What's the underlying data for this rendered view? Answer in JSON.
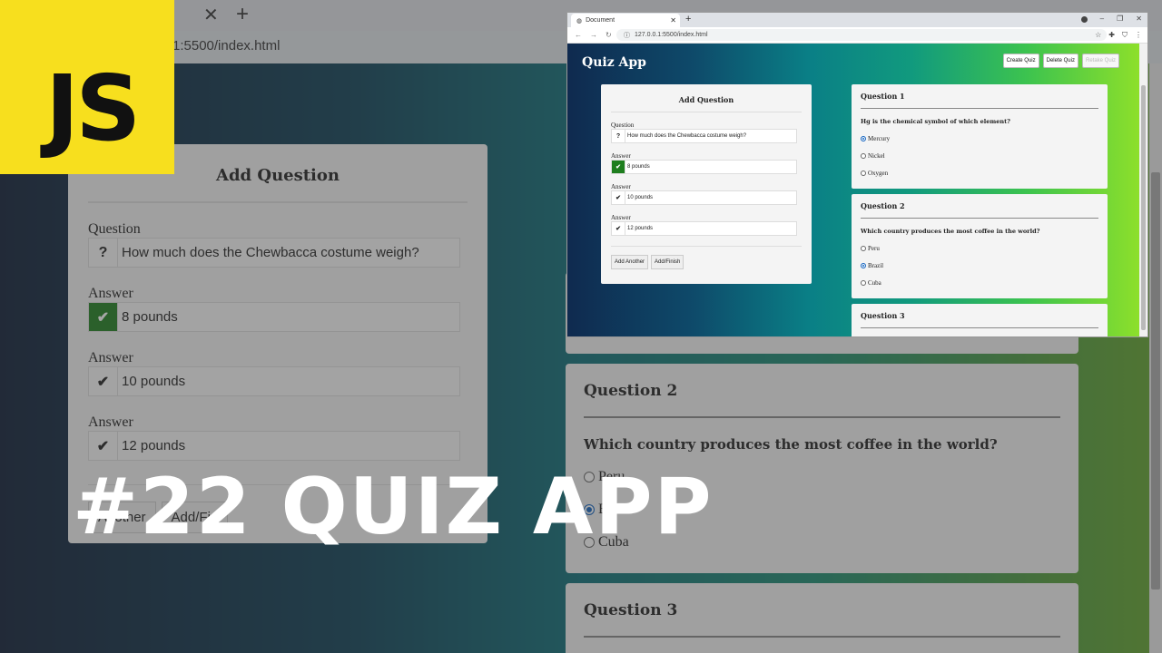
{
  "background": {
    "url": "1:5500/index.html",
    "add_card": {
      "title": "Add Question",
      "question_label": "Question",
      "question_value": "How much does the Chewbacca costume weigh?",
      "answers": [
        {
          "label": "Answer",
          "value": "8 pounds"
        },
        {
          "label": "Answer",
          "value": "10 pounds"
        },
        {
          "label": "Answer",
          "value": "12 pounds"
        }
      ],
      "btn_another": "Another",
      "btn_finish": "Add/Fin"
    },
    "q2": {
      "title": "Question 2",
      "text": "Which country produces the most coffee in the world?",
      "options": [
        "Peru",
        "Brazil",
        "Cuba"
      ]
    },
    "q3": {
      "title": "Question 3"
    }
  },
  "logo": {
    "text": "JS",
    "color": "#f7df1e"
  },
  "overlay_title": "#22 QUIZ APP",
  "inset": {
    "tab_title": "Document",
    "url": "127.0.0.1:5500/index.html",
    "app_title": "Quiz App",
    "header_buttons": [
      "Create Quiz",
      "Delete Quiz",
      "Retake Quiz"
    ],
    "add_card": {
      "title": "Add Question",
      "question_label": "Question",
      "question_icon": "?",
      "question_value": "How much does the Chewbacca costume weigh?",
      "answers": [
        {
          "label": "Answer",
          "value": "8 pounds",
          "correct": true
        },
        {
          "label": "Answer",
          "value": "10 pounds",
          "correct": false
        },
        {
          "label": "Answer",
          "value": "12 pounds",
          "correct": false
        }
      ],
      "btn_another": "Add Another",
      "btn_finish": "Add/Finish"
    },
    "questions": [
      {
        "title": "Question 1",
        "text": "Hg is the chemical symbol of which element?",
        "options": [
          "Mercury",
          "Nickel",
          "Oxygen"
        ],
        "selected": 0
      },
      {
        "title": "Question 2",
        "text": "Which country produces the most coffee in the world?",
        "options": [
          "Peru",
          "Brazil",
          "Cuba"
        ],
        "selected": 1
      },
      {
        "title": "Question 3"
      }
    ]
  }
}
